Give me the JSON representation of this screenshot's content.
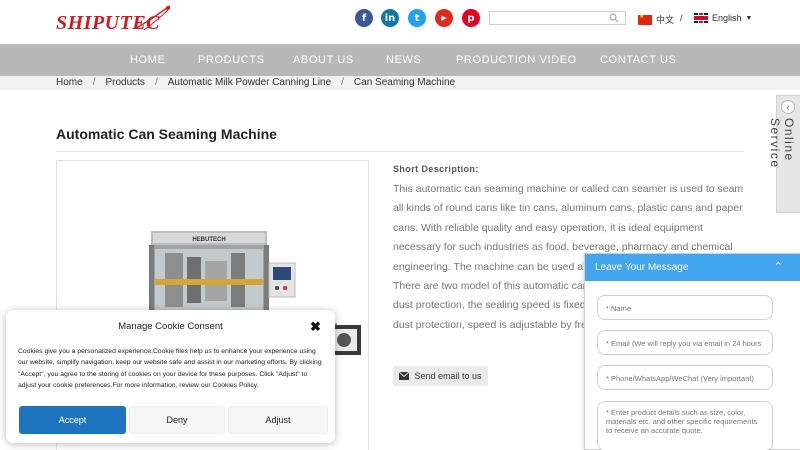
{
  "brand": {
    "logo_text": "SHIPUTEC",
    "accent": "#d8171c"
  },
  "social": [
    {
      "icon": "facebook-icon",
      "glyph": "f",
      "color": "#3b5998"
    },
    {
      "icon": "linkedin-icon",
      "glyph": "in",
      "color": "#0e76a8"
    },
    {
      "icon": "twitter-icon",
      "glyph": "t",
      "color": "#1da1f2"
    },
    {
      "icon": "youtube-icon",
      "glyph": "▶",
      "color": "#e02a20"
    },
    {
      "icon": "pinterest-icon",
      "glyph": "p",
      "color": "#e60023"
    }
  ],
  "search": {
    "placeholder": ""
  },
  "languages": {
    "chinese": "中文",
    "separator": "/",
    "english": "English"
  },
  "nav": [
    "HOME",
    "PRODUCTS",
    "ABOUT US",
    "NEWS",
    "PRODUCTION VIDEO",
    "CONTACT US"
  ],
  "breadcrumb": [
    "Home",
    "Products",
    "Automatic Milk Powder Canning Line",
    "Can Seaming Machine"
  ],
  "product": {
    "title": "Automatic Can Seaming Machine",
    "image_brand_label": "HEBUTECH",
    "short_label": "Short Description:",
    "description": [
      "This automatic can seaming machine or called can seamer is used to seam all kinds of round cans like tin cans, aluminum cans, plastic cans and paper cans. With reliable quality and easy operation, it is ideal equipment necessary for such industries as food, beverage, pharmacy and chemical engineering. The machine can be used alone or together with other filli",
      "There are two model of this automatic can s",
      "dust protection, the sealing speed is fixed; th",
      "dust protection, speed is adjustable by frequ"
    ],
    "email_button": "Send email to us"
  },
  "online_service": {
    "label": "Online Service"
  },
  "message_panel": {
    "title": "Leave Your Message",
    "fields": {
      "name": "* Name",
      "email": "* Email (We will reply you via email in 24 hours",
      "phone": "* Phone/WhatsApp/WeChat (Very important)",
      "details": "* Enter product details such as size, color, materials etc. and other specific requirements to receive an accurate quote."
    }
  },
  "cookie": {
    "title": "Manage Cookie Consent",
    "text": "Cookies give you a personalized experience,Cookie files help us to enhance your experience using our website, simplify navigation, keep our website safe and assist in our marketing efforts. By clicking \"Accept\", you agree to the storing of cookies on your device for these purposes. Click \"Adjust\" to adjust your cookie preferences.For more information, review our Cookies Policy.",
    "accept": "Accept",
    "deny": "Deny",
    "adjust": "Adjust"
  }
}
